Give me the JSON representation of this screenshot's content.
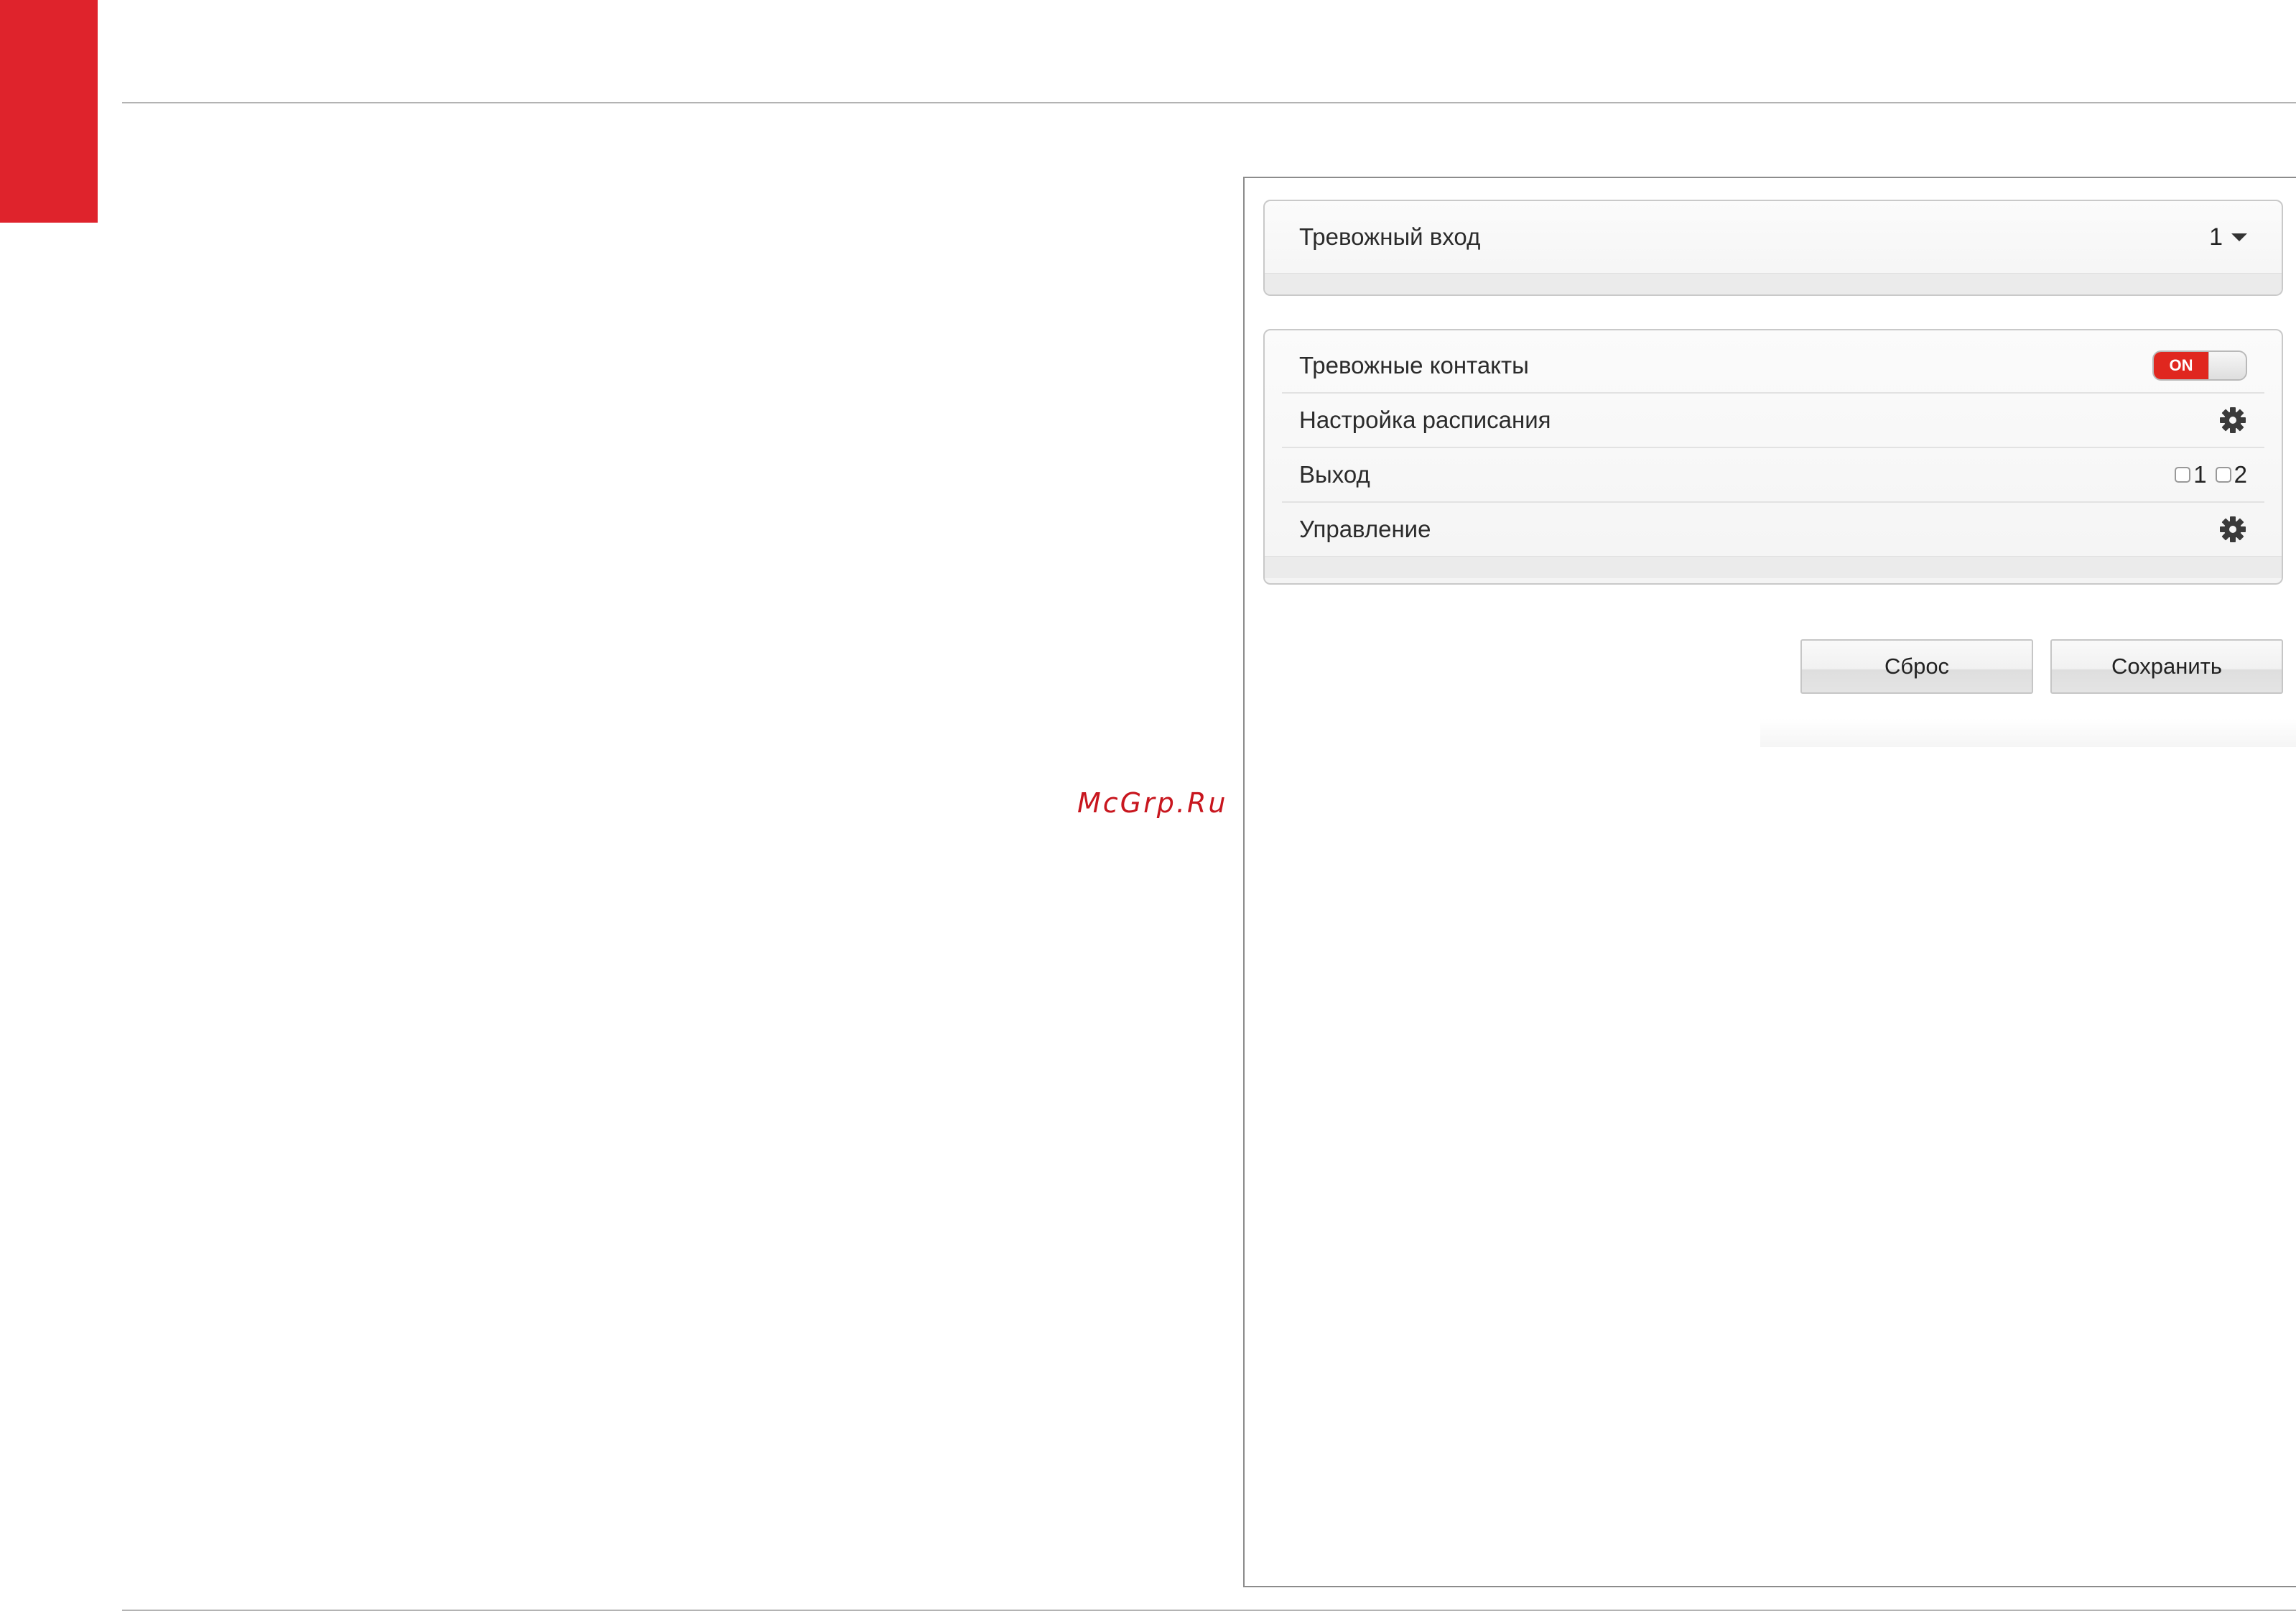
{
  "colors": {
    "accent": "#df232c",
    "toggle_on": "#e0271f"
  },
  "watermark": "McGrp.Ru",
  "alarm_input": {
    "label": "Тревожный вход",
    "selected": "1"
  },
  "settings": {
    "alarm_contacts": {
      "label": "Тревожные контакты",
      "state": "ON"
    },
    "schedule": {
      "label": "Настройка расписания",
      "icon": "gear-icon"
    },
    "output": {
      "label": "Выход",
      "options": [
        "1",
        "2"
      ],
      "checked": [
        false,
        false
      ]
    },
    "control": {
      "label": "Управление",
      "icon": "gear-icon"
    }
  },
  "buttons": {
    "reset": "Сброс",
    "save": "Сохранить"
  }
}
